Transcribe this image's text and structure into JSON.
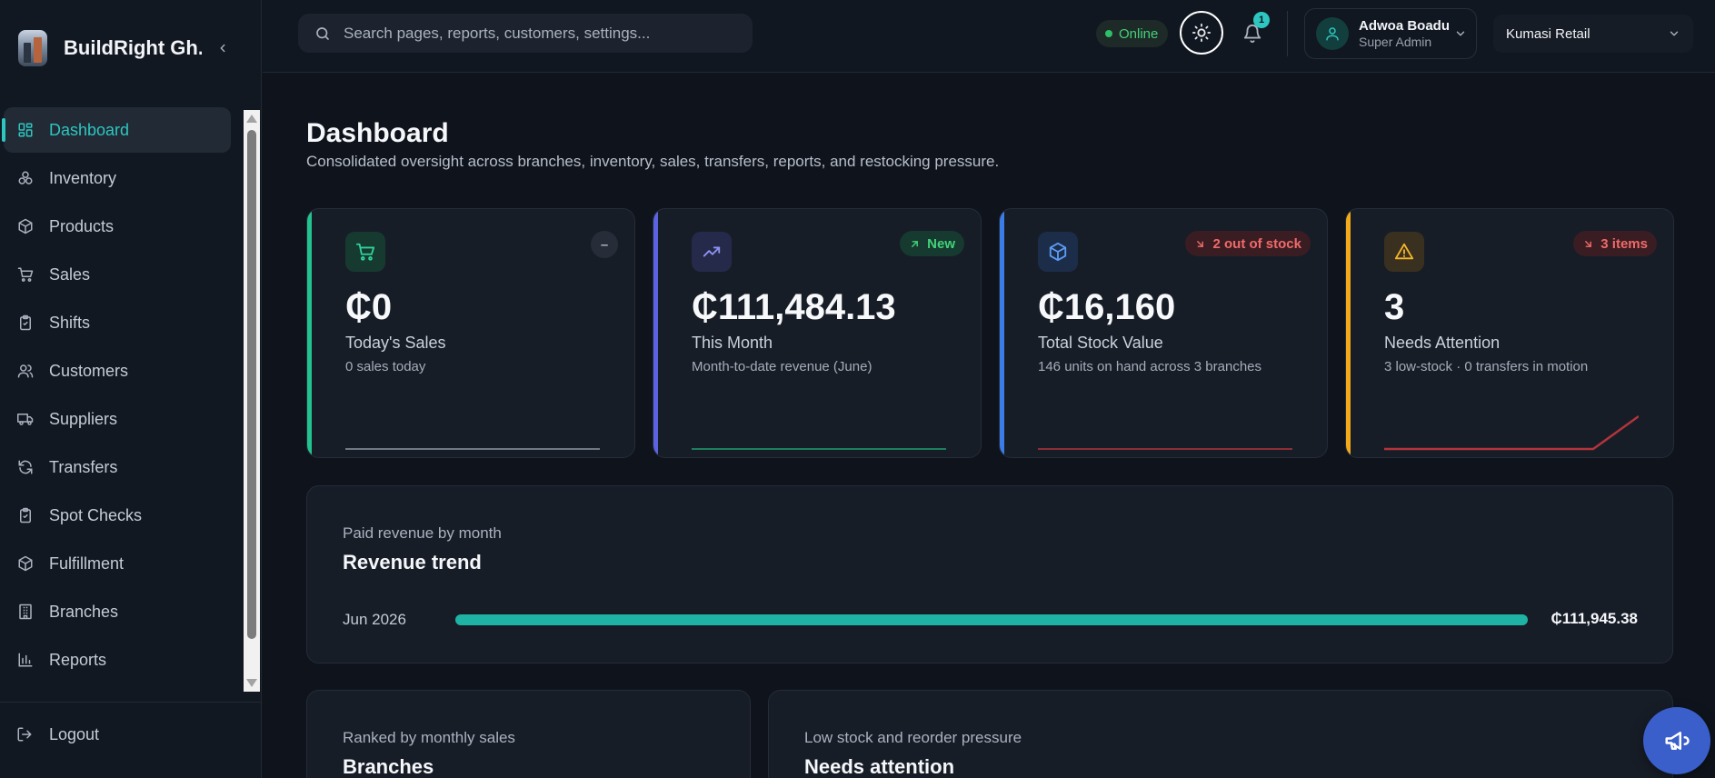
{
  "brand": {
    "name": "BuildRight Gh..."
  },
  "sidebar": {
    "items": [
      {
        "label": "Dashboard",
        "icon": "dashboard-icon",
        "active": true
      },
      {
        "label": "Inventory",
        "icon": "boxes-icon"
      },
      {
        "label": "Products",
        "icon": "package-icon"
      },
      {
        "label": "Sales",
        "icon": "cart-icon"
      },
      {
        "label": "Shifts",
        "icon": "clipboard-check-icon"
      },
      {
        "label": "Customers",
        "icon": "users-icon"
      },
      {
        "label": "Suppliers",
        "icon": "truck-icon"
      },
      {
        "label": "Transfers",
        "icon": "refresh-icon"
      },
      {
        "label": "Spot Checks",
        "icon": "clipboard-check-icon"
      },
      {
        "label": "Fulfillment",
        "icon": "package-icon"
      },
      {
        "label": "Branches",
        "icon": "building-icon"
      },
      {
        "label": "Reports",
        "icon": "bar-chart-icon"
      }
    ],
    "logout": "Logout"
  },
  "topbar": {
    "search_placeholder": "Search pages, reports, customers, settings...",
    "status": "Online",
    "notification_count": "1",
    "user_name": "Adwoa Boadu",
    "user_role": "Super Admin",
    "branch": "Kumasi Retail"
  },
  "page": {
    "title": "Dashboard",
    "subtitle": "Consolidated oversight across branches, inventory, sales, transfers, reports, and restocking pressure."
  },
  "kpis": [
    {
      "value": "₵0",
      "label": "Today's Sales",
      "desc": "0 sales today",
      "badge": "–",
      "accent": "#22c38e",
      "icon": "cart-icon"
    },
    {
      "value": "₵111,484.13",
      "label": "This Month",
      "desc": "Month-to-date revenue (June)",
      "badge": "New",
      "accent": "#5b63e0",
      "icon": "trending-up-icon"
    },
    {
      "value": "₵16,160",
      "label": "Total Stock Value",
      "desc": "146 units on hand across 3 branches",
      "badge": "2 out of stock",
      "accent": "#3b7de8",
      "icon": "cube-icon"
    },
    {
      "value": "3",
      "label": "Needs Attention",
      "desc": "3 low-stock · 0 transfers in motion",
      "badge": "3 items",
      "accent": "#f2a91a",
      "icon": "alert-triangle-icon"
    }
  ],
  "revenue": {
    "kicker": "Paid revenue by month",
    "title": "Revenue trend",
    "rows": [
      {
        "month": "Jun 2026",
        "value": "₵111,945.38",
        "fraction": 1.0
      }
    ]
  },
  "branches_panel": {
    "kicker": "Ranked by monthly sales",
    "title": "Branches"
  },
  "attention_panel": {
    "kicker": "Low stock and reorder pressure",
    "title": "Needs attention"
  },
  "colors": {
    "accent": "#2ec6c0",
    "bar": "#1fb3a5",
    "danger": "#f06a6a",
    "success": "#43d17a"
  }
}
